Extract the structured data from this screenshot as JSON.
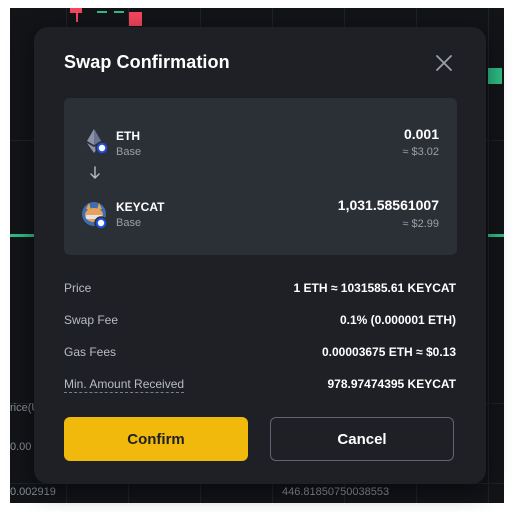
{
  "background": {
    "left_label_top": "rice(U",
    "left_label_mid": "0.00",
    "bottom_left_value": "0.002919",
    "bottom_mid_value": "446.81850750038553"
  },
  "modal": {
    "title": "Swap Confirmation",
    "close_icon": "close-icon",
    "from": {
      "token": "ETH",
      "chain": "Base",
      "amount": "0.001",
      "usd": "≈ $3.02",
      "icon": "eth-icon"
    },
    "to": {
      "token": "KEYCAT",
      "chain": "Base",
      "amount": "1,031.58561007",
      "usd": "≈ $2.99",
      "icon": "keycat-icon"
    },
    "details": [
      {
        "label": "Price",
        "value": "1 ETH ≈ 1031585.61 KEYCAT"
      },
      {
        "label": "Swap Fee",
        "value": "0.1% (0.000001 ETH)"
      },
      {
        "label": "Gas Fees",
        "value": "0.00003675 ETH ≈ $0.13"
      },
      {
        "label": "Min. Amount Received",
        "value": "978.97474395 KEYCAT"
      }
    ],
    "confirm_label": "Confirm",
    "cancel_label": "Cancel"
  },
  "colors": {
    "accent": "#f0b90b",
    "modal_bg": "#1e2026",
    "panel_bg": "#2b2f36",
    "up_candle": "#2ebd85",
    "down_candle": "#f6465d"
  }
}
